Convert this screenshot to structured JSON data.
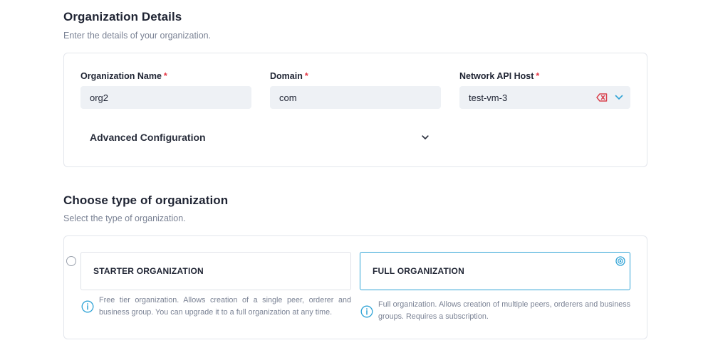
{
  "org_details": {
    "title": "Organization Details",
    "subtitle": "Enter the details of your organization.",
    "fields": {
      "org_name": {
        "label": "Organization Name",
        "required": "*",
        "value": "org2"
      },
      "domain": {
        "label": "Domain",
        "required": "*",
        "value": "com"
      },
      "network_api_host": {
        "label": "Network API Host",
        "required": "*",
        "value": "test-vm-3",
        "clear_icon": "clear-backspace-icon",
        "dropdown_icon": "chevron-down-icon"
      }
    },
    "advanced": {
      "label": "Advanced Configuration",
      "icon": "chevron-down-icon"
    }
  },
  "org_type": {
    "title": "Choose type of organization",
    "subtitle": "Select the type of organization.",
    "options": [
      {
        "label": "STARTER ORGANIZATION",
        "description": "Free tier organization. Allows creation of a single peer, orderer and business group. You can upgrade it to a full organization at any time.",
        "selected": false
      },
      {
        "label": "FULL ORGANIZATION",
        "description": "Full organization. Allows creation of multiple peers, orderers and business groups. Requires a subscription.",
        "selected": true
      }
    ]
  },
  "colors": {
    "accent": "#2fa3d6",
    "required": "#e53946",
    "clear_icon": "#d9434f",
    "field_bg": "#eef1f5"
  }
}
